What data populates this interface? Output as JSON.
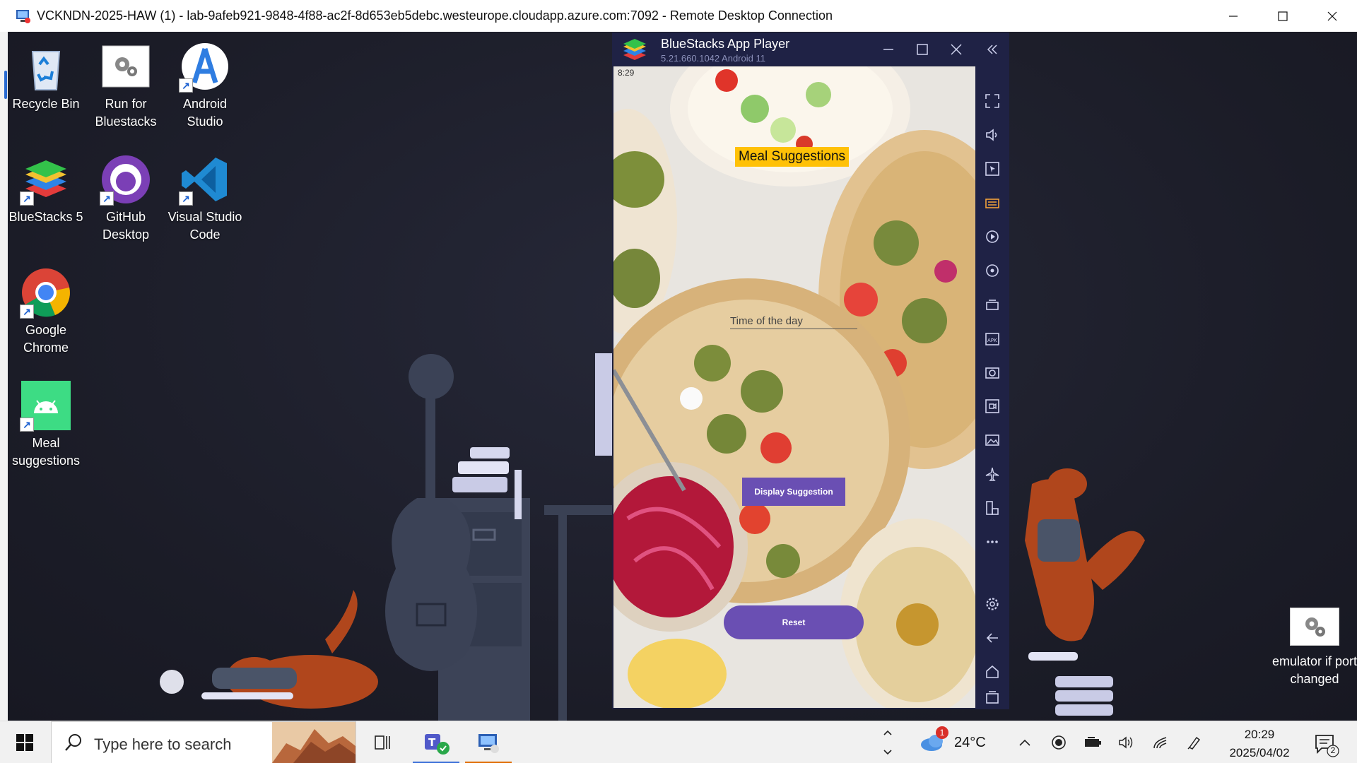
{
  "rdp": {
    "title": "VCKNDN-2025-HAW (1) - lab-9afeb921-9848-4f88-ac2f-8d653eb5debc.westeurope.cloudapp.azure.com:7092 - Remote Desktop Connection"
  },
  "desktop_icons": {
    "recycle_bin": "Recycle Bin",
    "run_bluestacks": "Run for Bluestacks",
    "android_studio": "Android Studio",
    "bluestacks5": "BlueStacks 5",
    "github_desktop": "GitHub Desktop",
    "vscode": "Visual Studio Code",
    "chrome": "Google Chrome",
    "meal_suggestions": "Meal suggestions",
    "emulator_port": "emulator if port changed"
  },
  "bluestacks": {
    "title": "BlueStacks App Player",
    "version": "5.21.660.1042",
    "android": "Android 11"
  },
  "app": {
    "status_time": "8:29",
    "title": "Meal Suggestions",
    "time_placeholder": "Time of the day",
    "display_button": "Display Suggestion",
    "reset_button": "Reset"
  },
  "taskbar": {
    "search_placeholder": "Type here to search",
    "weather_temp": "24°C",
    "weather_badge": "1",
    "time": "20:29",
    "date": "2025/04/02",
    "notification_count": "2"
  },
  "colors": {
    "app_button": "#6a4fb3",
    "title_highlight": "#ffc107",
    "bluestacks_chrome": "#1f2245"
  }
}
